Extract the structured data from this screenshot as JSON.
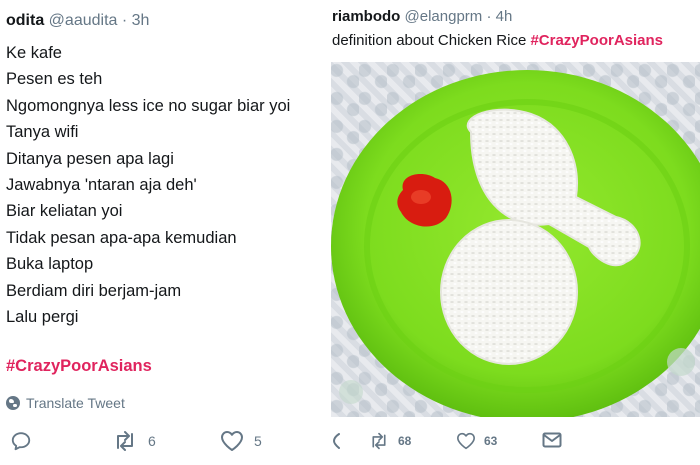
{
  "left_tweet": {
    "display_name": "odita",
    "handle": "@aaudita",
    "separator": "·",
    "time": "3h",
    "lines": [
      "Ke kafe",
      "Pesen es teh",
      "Ngomongnya less ice no sugar biar yoi",
      "Tanya wifi",
      "Ditanya pesen apa lagi",
      "Jawabnya 'ntaran aja deh'",
      "Biar keliatan yoi",
      "Tidak pesan apa-apa kemudian",
      "Buka laptop",
      "Berdiam diri berjam-jam",
      "Lalu pergi"
    ],
    "hashtag": "#CrazyPoorAsians",
    "translate_label": "Translate Tweet",
    "retweet_count": "6",
    "like_count": "5"
  },
  "right_tweet": {
    "display_name": "riambodo",
    "handle": "@elangprm",
    "separator": "·",
    "time": "4h",
    "text_prefix": "definition about Chicken Rice ",
    "hashtag": "#CrazyPoorAsians",
    "retweet_count": "68",
    "like_count": "63"
  },
  "colors": {
    "hashtag": "#e0245e",
    "muted": "#657786",
    "plate": "#7ddc1e",
    "sauce": "#d81c10"
  },
  "icons": [
    "reply-icon",
    "retweet-icon",
    "like-icon",
    "globe-icon",
    "message-icon"
  ]
}
